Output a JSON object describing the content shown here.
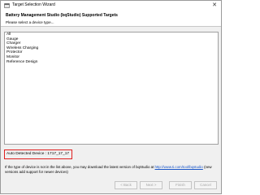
{
  "window": {
    "title": "Target Selection Wizard",
    "close_glyph": "✕"
  },
  "header": {
    "title": "Battery Management Studio (bqStudio) Supported Targets",
    "subtitle": "Please select a device type..."
  },
  "device_types": [
    "All",
    "Gauge",
    "Charger",
    "Wireless Charging",
    "Protector",
    "Monitor",
    "Reference Design"
  ],
  "detected": {
    "label": "Auto Detected Device : 1717_17_17",
    "highlight_color": "#e02020"
  },
  "note": {
    "text_before": "If the type of device is not in the list above, you may download the latest version of bqStudio at ",
    "link": "http://www.ti.com/tool/bqstudio",
    "text_after": " (new versions add support for newer devices)"
  },
  "buttons": {
    "back": "< Back",
    "next": "Next >",
    "finish": "Finish",
    "cancel": "Cancel"
  },
  "icons": {
    "app": "wizard-icon",
    "close": "close-icon"
  }
}
